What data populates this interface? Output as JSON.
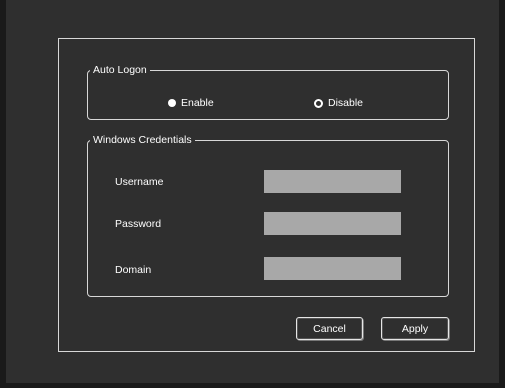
{
  "auto_logon": {
    "legend": "Auto Logon",
    "options": [
      {
        "label": "Enable",
        "selected": true
      },
      {
        "label": "Disable",
        "selected": false
      }
    ]
  },
  "credentials": {
    "legend": "Windows Credentials",
    "fields": {
      "username": {
        "label": "Username",
        "value": ""
      },
      "password": {
        "label": "Password",
        "value": ""
      },
      "domain": {
        "label": "Domain",
        "value": ""
      }
    }
  },
  "buttons": {
    "cancel": "Cancel",
    "apply": "Apply"
  },
  "colors": {
    "background": "#2f2f2f",
    "border": "#d8d8d8",
    "input_fill": "#a8a8a8",
    "text": "#ffffff"
  }
}
